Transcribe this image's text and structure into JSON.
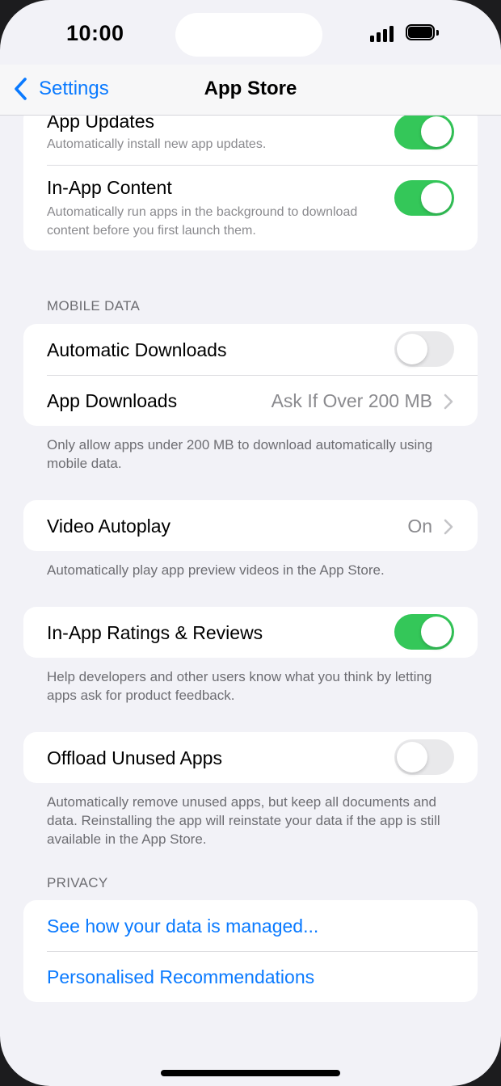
{
  "status_bar": {
    "time": "10:00"
  },
  "nav": {
    "back_label": "Settings",
    "title": "App Store"
  },
  "automatic_downloads_card": {
    "app_updates": {
      "title": "App Updates",
      "subtitle": "Automatically install new app updates.",
      "enabled": true
    },
    "in_app_content": {
      "title": "In-App Content",
      "subtitle": "Automatically run apps in the background to download content before you first launch them.",
      "enabled": true
    }
  },
  "mobile_data": {
    "header": "MOBILE DATA",
    "automatic_downloads": {
      "title": "Automatic Downloads",
      "enabled": false
    },
    "app_downloads": {
      "title": "App Downloads",
      "value": "Ask If Over 200 MB"
    },
    "footer": "Only allow apps under 200 MB to download automatically using mobile data."
  },
  "video_autoplay": {
    "title": "Video Autoplay",
    "value": "On",
    "footer": "Automatically play app preview videos in the App Store."
  },
  "ratings_reviews": {
    "title": "In-App Ratings & Reviews",
    "enabled": true,
    "footer": "Help developers and other users know what you think by letting apps ask for product feedback."
  },
  "offload": {
    "title": "Offload Unused Apps",
    "enabled": false,
    "footer": "Automatically remove unused apps, but keep all documents and data. Reinstalling the app will reinstate your data if the app is still available in the App Store."
  },
  "privacy": {
    "header": "PRIVACY",
    "links": [
      "See how your data is managed...",
      "Personalised Recommendations"
    ]
  },
  "colors": {
    "accent": "#0a7aff",
    "toggle_on": "#34c759",
    "toggle_off": "#e9e9eb",
    "background": "#f2f2f7"
  }
}
